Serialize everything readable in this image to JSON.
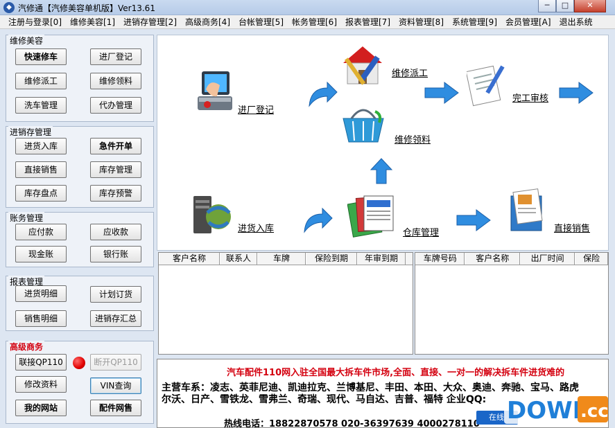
{
  "window": {
    "title": "汽修通【汽修美容单机版】Ver13.61",
    "minimize": "─",
    "maximize": "□",
    "close": "✕"
  },
  "menu": [
    "注册与登录[0]",
    "维修美容[1]",
    "进销存管理[2]",
    "高级商务[4]",
    "台帐管理[5]",
    "帐务管理[6]",
    "报表管理[7]",
    "资料管理[8]",
    "系统管理[9]",
    "会员管理[A]",
    "退出系统"
  ],
  "groups": {
    "repair": {
      "title": "维修美容",
      "buttons": [
        "快速修车",
        "进厂登记",
        "维修派工",
        "维修领料",
        "洗车管理",
        "代办管理"
      ]
    },
    "inventory": {
      "title": "进销存管理",
      "buttons": [
        "进货入库",
        "急件开单",
        "直接销售",
        "库存管理",
        "库存盘点",
        "库存预警"
      ]
    },
    "accounts": {
      "title": "账务管理",
      "buttons": [
        "应付款",
        "应收款",
        "现金账",
        "银行账"
      ]
    },
    "reports": {
      "title": "报表管理",
      "buttons": [
        "进货明细",
        "计划订货",
        "销售明细",
        "进销存汇总"
      ]
    },
    "business": {
      "title": "高级商务",
      "buttons": [
        "联接QP110",
        "断开QP110",
        "修改资料",
        "VIN查询",
        "我的网站",
        "配件网售"
      ]
    }
  },
  "workflow": {
    "entry": "进厂登记",
    "dispatch": "维修派工",
    "parts": "维修领料",
    "review": "完工审核",
    "purchase": "进货入库",
    "warehouse": "仓库管理",
    "direct_sale": "直接销售"
  },
  "tables": {
    "left_headers": [
      "客户名称",
      "联系人",
      "车牌",
      "保险到期",
      "年审到期"
    ],
    "right_headers": [
      "车牌号码",
      "客户名称",
      "出厂时间",
      "保险"
    ]
  },
  "ad": {
    "headline": "汽车配件110网入驻全国最大拆车件市场,全面、直接、一对一的解决拆车件进货难的",
    "brands_line1": "主营车系：凌志、英菲尼迪、凯迪拉克、兰博基尼、丰田、本田、大众、奥迪、奔驰、宝马、路虎",
    "brands_line2": "尔沃、日产、雪铁龙、雪弗兰、奇瑞、现代、马自达、吉普、福特 企业QQ:",
    "hotline": "热线电话：18822870578 020-36397639 4000278110",
    "chat": "在线"
  },
  "watermark": "DOWN.cc",
  "colors": {
    "accent_red": "#d4000f",
    "arrow_blue": "#2f8de0",
    "title_bar": "#c9daf0"
  }
}
